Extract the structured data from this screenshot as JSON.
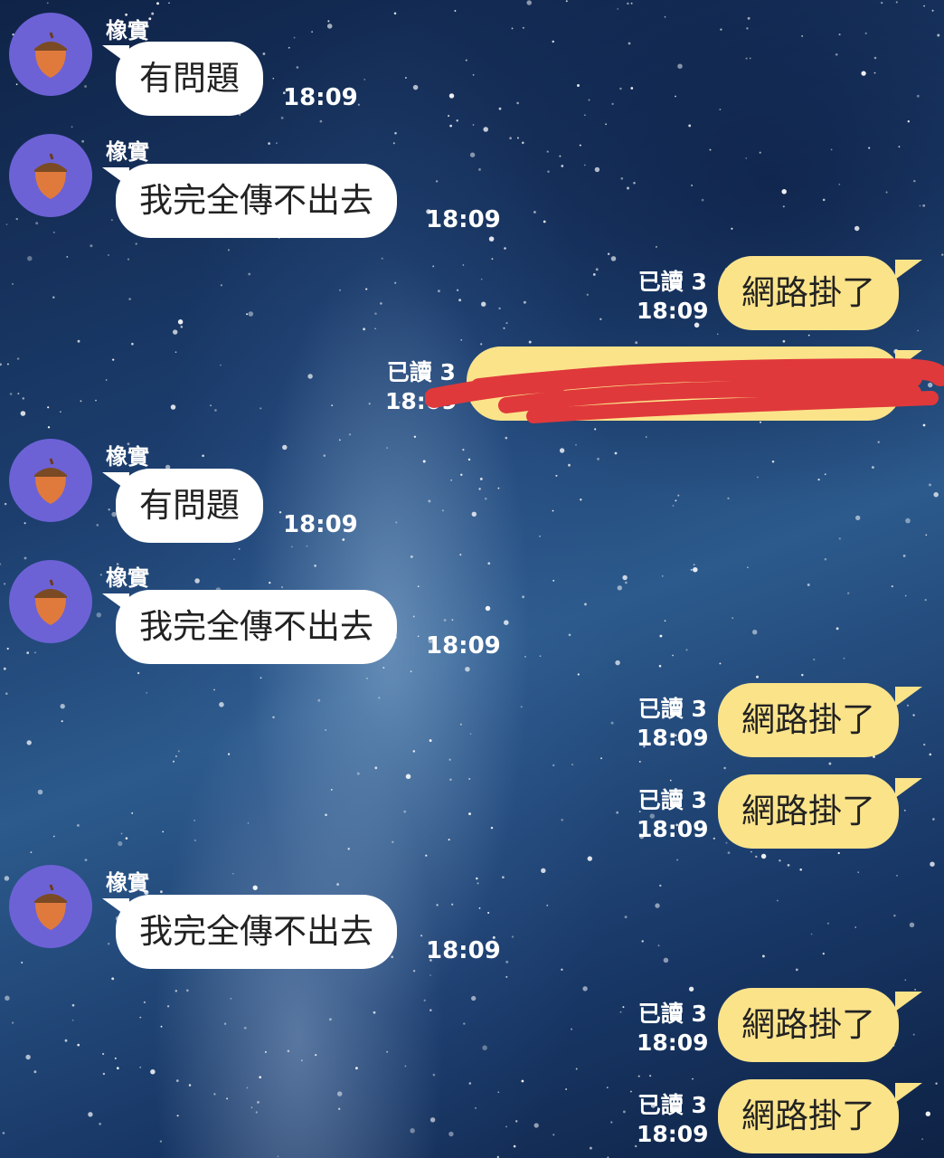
{
  "contact": {
    "name": "橡實"
  },
  "colors": {
    "incoming_bubble": "#ffffff",
    "outgoing_bubble": "#fbe38a",
    "avatar_bg": "#6c62d6",
    "redaction": "#e0393b"
  },
  "icons": {
    "avatar": "acorn-icon"
  },
  "messages": [
    {
      "direction": "in",
      "sender": "橡實",
      "text": "有問題",
      "time": "18:09"
    },
    {
      "direction": "in",
      "sender": "橡實",
      "text": "我完全傳不出去",
      "time": "18:09"
    },
    {
      "direction": "out",
      "read": "已讀 3",
      "text": "網路掛了",
      "time": "18:09"
    },
    {
      "direction": "out",
      "read": "已讀 3",
      "text": "",
      "time": "18:09",
      "redacted": true
    },
    {
      "direction": "in",
      "sender": "橡實",
      "text": "有問題",
      "time": "18:09"
    },
    {
      "direction": "in",
      "sender": "橡實",
      "text": "我完全傳不出去",
      "time": "18:09"
    },
    {
      "direction": "out",
      "read": "已讀 3",
      "text": "網路掛了",
      "time": "18:09"
    },
    {
      "direction": "out",
      "read": "已讀 3",
      "text": "網路掛了",
      "time": "18:09"
    },
    {
      "direction": "in",
      "sender": "橡實",
      "text": "我完全傳不出去",
      "time": "18:09"
    },
    {
      "direction": "out",
      "read": "已讀 3",
      "text": "網路掛了",
      "time": "18:09"
    },
    {
      "direction": "out",
      "read": "已讀 3",
      "text": "網路掛了",
      "time": "18:09"
    }
  ]
}
